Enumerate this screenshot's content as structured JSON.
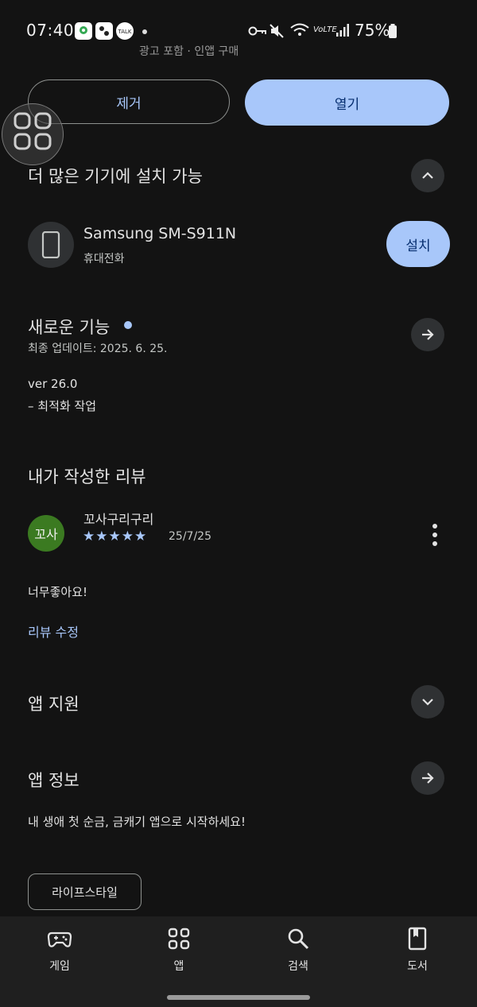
{
  "status_bar": {
    "time": "07:40",
    "battery": "75%",
    "left_icons": [
      "maps-icon",
      "app-icon",
      "talk-icon"
    ],
    "talk_label": "TALK",
    "volte_label": "VoLTE",
    "right_icons": [
      "key-icon",
      "mute-icon",
      "wifi-icon",
      "volte-icon",
      "signal-icon",
      "battery-icon"
    ]
  },
  "cut_text": "광고 포함 · 인앱 구매",
  "actions": {
    "uninstall": "제거",
    "open": "열기"
  },
  "more_devices": {
    "title": "더 많은 기기에 설치 가능",
    "device_name": "Samsung SM-S911N",
    "device_type": "휴대전화",
    "install": "설치"
  },
  "whats_new": {
    "title": "새로운 기능",
    "updated": "최종 업데이트: 2025. 6. 25.",
    "version": "ver 26.0",
    "note": "– 최적화 작업"
  },
  "my_review": {
    "title": "내가 작성한 리뷰",
    "avatar_text": "꼬사",
    "reviewer": "꼬사구리구리",
    "stars": "★★★★★",
    "rating": 5,
    "date": "25/7/25",
    "text": "너무좋아요!",
    "edit": "리뷰 수정"
  },
  "app_support": {
    "title": "앱 지원"
  },
  "app_info": {
    "title": "앱 정보",
    "description": "내 생애 첫 순금, 금캐기 앱으로 시작하세요!",
    "category_chip": "라이프스타일"
  },
  "bottom_nav": {
    "items": [
      {
        "label": "게임",
        "icon": "gamepad-icon"
      },
      {
        "label": "앱",
        "icon": "apps-grid-icon"
      },
      {
        "label": "검색",
        "icon": "search-icon"
      },
      {
        "label": "도서",
        "icon": "book-icon"
      }
    ]
  },
  "colors": {
    "background": "#131313",
    "accent": "#a8c7fa",
    "on_accent": "#062e6f",
    "avatar_green": "#3b7a21"
  }
}
